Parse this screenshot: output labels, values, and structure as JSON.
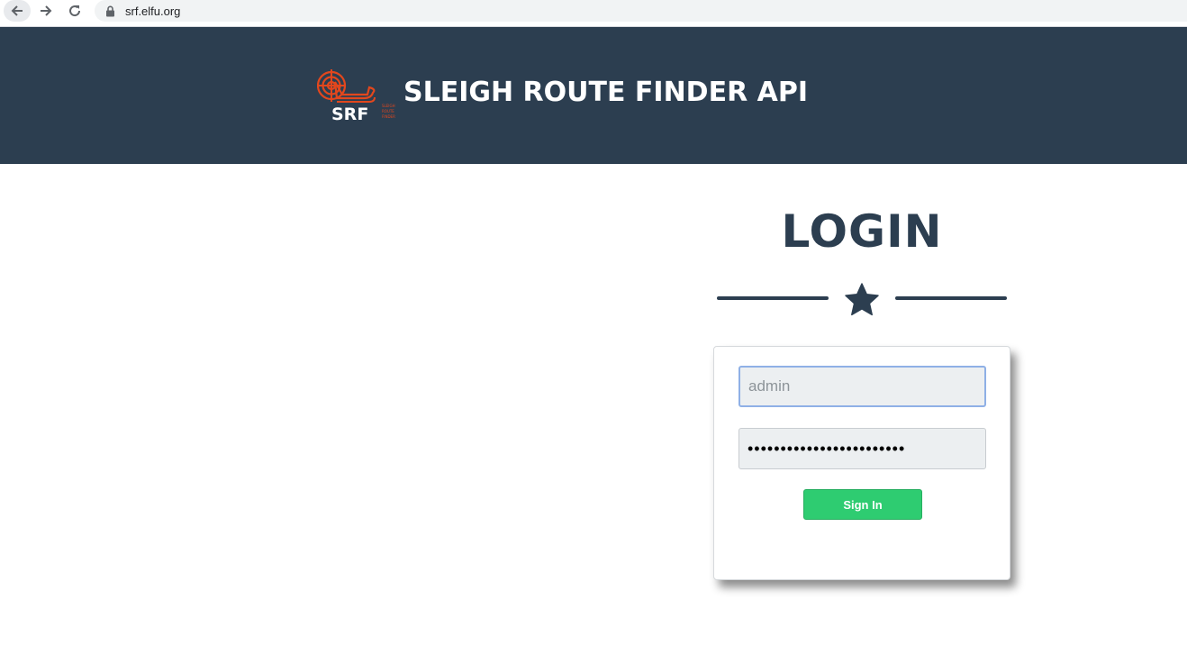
{
  "browser": {
    "url": "srf.elfu.org"
  },
  "header": {
    "logo_text": "SRF",
    "logo_subtext": "SLEIGH ROUTE FINDER",
    "title": "SLEIGH ROUTE FINDER API",
    "background_color": "#2c3e50",
    "logo_color": "#e2471d"
  },
  "login": {
    "heading": "LOGIN",
    "username_value": "admin",
    "password_value": "••••••••••••••••••••••••",
    "signin_label": "Sign In",
    "button_color": "#2ecc71"
  },
  "icons": {
    "divider": "star-icon",
    "back": "arrow-left-icon",
    "forward": "arrow-right-icon",
    "reload": "reload-icon",
    "lock": "lock-icon"
  }
}
